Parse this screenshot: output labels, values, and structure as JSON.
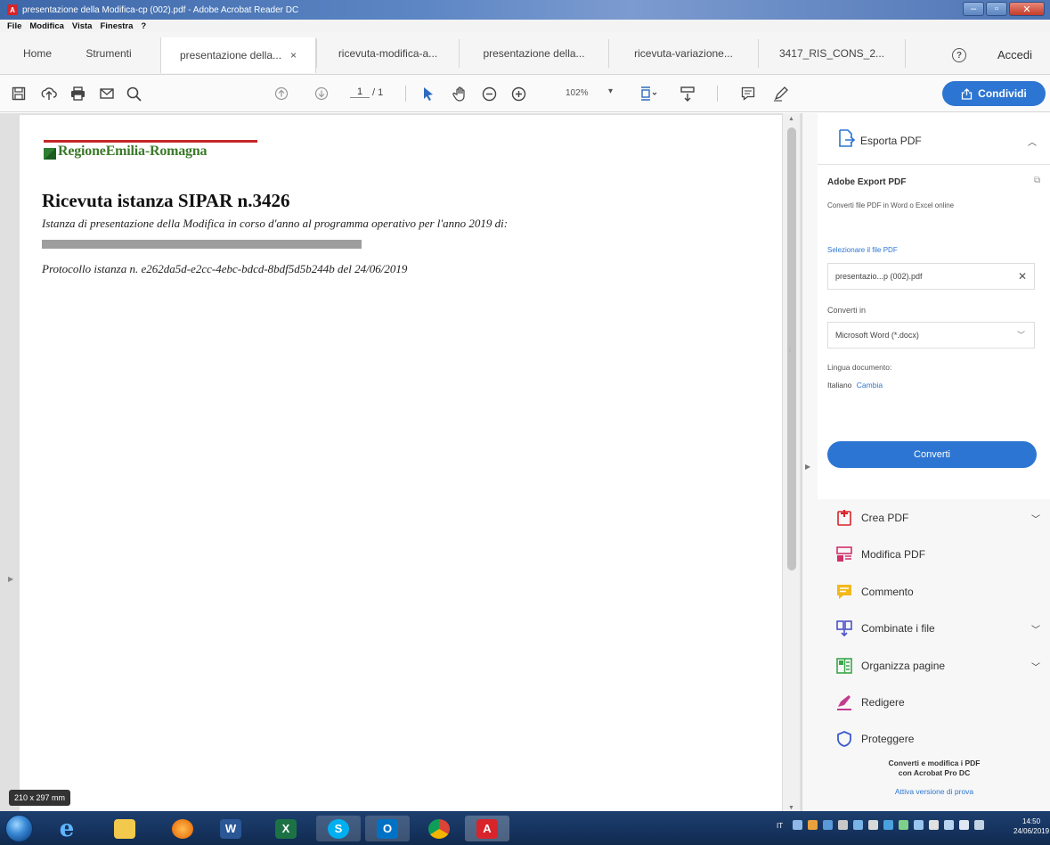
{
  "window": {
    "title": "presentazione della Modifica-cp (002).pdf - Adobe Acrobat Reader DC",
    "icon_name": "acrobat-icon",
    "controls": [
      "minimize",
      "maximize",
      "close"
    ]
  },
  "menu": {
    "items": [
      "File",
      "Modifica",
      "Vista",
      "Finestra",
      "?"
    ]
  },
  "tabs": {
    "home": "Home",
    "tools": "Strumenti",
    "documents": [
      {
        "label": "presentazione della...",
        "active": true,
        "close": "×"
      },
      {
        "label": "ricevuta-modifica-a...",
        "active": false
      },
      {
        "label": "presentazione della...",
        "active": false
      },
      {
        "label": "ricevuta-variazione...",
        "active": false
      },
      {
        "label": "3417_RIS_CONS_2...",
        "active": false
      }
    ],
    "help": "?",
    "sign_in": "Accedi"
  },
  "toolbar": {
    "icons": [
      "save-icon",
      "upload-icon",
      "print-icon",
      "email-icon",
      "search-icon",
      "page-up-icon",
      "page-down-icon",
      "select-tool-icon",
      "hand-tool-icon",
      "zoom-out-icon",
      "zoom-in-icon",
      "fit-page-icon",
      "scroll-mode-icon",
      "comment-icon",
      "pen-icon"
    ],
    "current_page": "1",
    "total_pages": "/ 1",
    "zoom": "102%",
    "share_label": "Condividi"
  },
  "document": {
    "logo_text": "RegioneEmilia-Romagna",
    "title": "Ricevuta istanza SIPAR n.3426",
    "subtitle": "Istanza di presentazione della Modifica in corso d'anno al programma operativo per l'anno 2019 di:",
    "protocol": "Protocollo istanza n. e262da5d-e2cc-4ebc-bdcd-8bdf5d5b244b del 24/06/2019",
    "page_size": "210 x 297 mm"
  },
  "right_panel": {
    "export_header": "Esporta PDF",
    "export_title": "Adobe Export PDF",
    "export_desc": "Converti file PDF in Word o Excel online",
    "select_label": "Selezionare il file PDF",
    "selected_file": "presentazio...p (002).pdf",
    "convert_to_label": "Converti in",
    "convert_to_value": "Microsoft Word (*.docx)",
    "language_label": "Lingua documento:",
    "language_value": "Italiano",
    "language_change": "Cambia",
    "convert_button": "Converti",
    "tools": [
      {
        "label": "Crea PDF",
        "icon": "create-pdf-icon",
        "expandable": true,
        "color": "#d8242a"
      },
      {
        "label": "Modifica PDF",
        "icon": "edit-pdf-icon",
        "expandable": false,
        "color": "#d1306b"
      },
      {
        "label": "Commento",
        "icon": "comment-icon",
        "expandable": false,
        "color": "#f2b91d"
      },
      {
        "label": "Combinate i file",
        "icon": "combine-files-icon",
        "expandable": true,
        "color": "#4a51c8"
      },
      {
        "label": "Organizza pagine",
        "icon": "organize-pages-icon",
        "expandable": true,
        "color": "#3aa54a"
      },
      {
        "label": "Redigere",
        "icon": "redact-icon",
        "expandable": false,
        "color": "#c23c8e"
      },
      {
        "label": "Proteggere",
        "icon": "protect-icon",
        "expandable": false,
        "color": "#3d5bcc"
      }
    ],
    "promo_line1": "Converti e modifica i PDF",
    "promo_line2": "con Acrobat Pro DC",
    "promo_link": "Attiva versione di prova"
  },
  "taskbar": {
    "apps": [
      "internet-explorer-icon",
      "file-explorer-icon",
      "firefox-icon",
      "word-icon",
      "excel-icon",
      "skype-icon",
      "outlook-icon",
      "chrome-icon",
      "acrobat-icon"
    ],
    "language": "IT",
    "time": "14:50",
    "date": "24/06/2019"
  }
}
